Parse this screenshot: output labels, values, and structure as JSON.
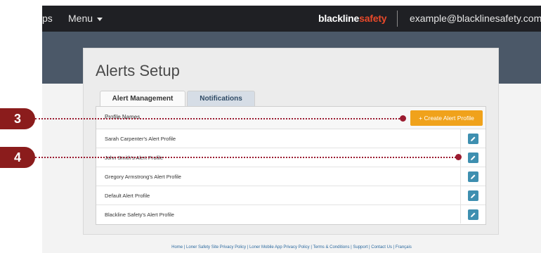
{
  "navbar": {
    "left_fragment": "ps",
    "menu_label": "Menu",
    "logo_part1": "blackline",
    "logo_part2": "safety",
    "user_email": "example@blacklinesafety.com"
  },
  "page": {
    "title": "Alerts Setup"
  },
  "tabs": [
    {
      "label": "Alert Management",
      "active": true
    },
    {
      "label": "Notifications",
      "active": false
    }
  ],
  "table": {
    "header": "Profile Names",
    "create_button_label": "+ Create Alert Profile",
    "rows": [
      {
        "name": "Sarah Carpenter's Alert Profile"
      },
      {
        "name": "John Smith's Alert Profile"
      },
      {
        "name": "Gregory Armstrong's Alert Profile"
      },
      {
        "name": "Default Alert Profile"
      },
      {
        "name": "Blackline Safety's Alert Profile"
      }
    ]
  },
  "footer": {
    "links_text": "Home | Loner Safety Site Privacy Policy | Loner Mobile App Privacy Policy | Terms & Conditions | Support | Contact Us | Français"
  },
  "callouts": [
    {
      "number": "3"
    },
    {
      "number": "4"
    }
  ],
  "colors": {
    "navbar": "#1f2024",
    "accent_orange": "#f0a21b",
    "edit_button": "#3e8fb0",
    "callout": "#9b1b30",
    "logo_accent": "#e8492a"
  },
  "icons": {
    "edit": "pencil-icon",
    "menu_caret": "caret-down-icon"
  }
}
